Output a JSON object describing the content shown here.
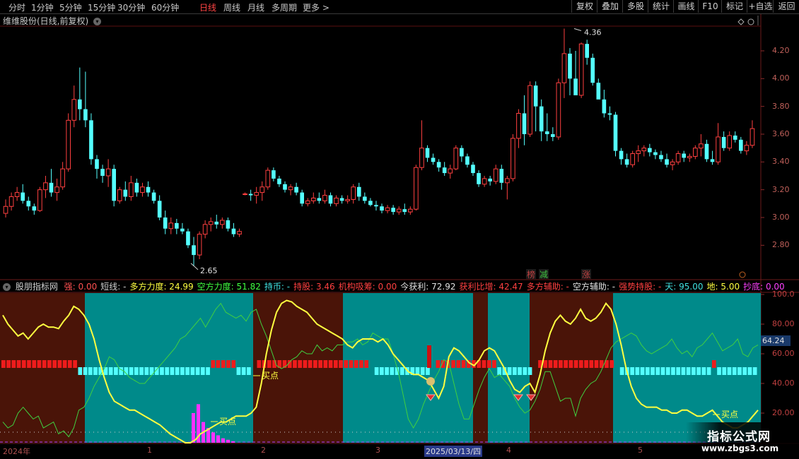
{
  "toolbar": {
    "timeframes": [
      "分时",
      "1分钟",
      "5分钟",
      "15分钟",
      "30分钟",
      "60分钟",
      "日线",
      "周线",
      "月线",
      "多周期",
      "更多 >"
    ],
    "active": "日线",
    "buttons": [
      "复权",
      "叠加",
      "多股",
      "统计",
      "画线",
      "F10",
      "标记",
      "+自选",
      "返回"
    ]
  },
  "stock": {
    "title": "维维股份(日线,前复权)"
  },
  "price_axis": {
    "labels": [
      "4.20",
      "4.00",
      "3.80",
      "3.60",
      "3.40",
      "3.20",
      "3.00",
      "2.80"
    ]
  },
  "price_annotations": {
    "high": "4.36",
    "low": "2.65"
  },
  "event_tags": [
    "榜",
    "减",
    "涨"
  ],
  "indicator": {
    "name": "股朋指标网",
    "params": [
      {
        "label": "强: 0.00",
        "color": "#ff5050"
      },
      {
        "label": "短线: -",
        "color": "#d0d0d0"
      },
      {
        "label": "多方力度: 24.99",
        "color": "#ffff40"
      },
      {
        "label": "空方力度: 51.82",
        "color": "#40ff40"
      },
      {
        "label": "持币: -",
        "color": "#40e0e0"
      },
      {
        "label": "持股: 3.46",
        "color": "#ff4040"
      },
      {
        "label": "机构吸筹: 0.00",
        "color": "#ff4040"
      },
      {
        "label": "今获利: 72.92",
        "color": "#e0e0e0"
      },
      {
        "label": "获利比增: 42.47",
        "color": "#ff4040"
      },
      {
        "label": "多方辅助: -",
        "color": "#ff4040"
      },
      {
        "label": "空方辅助: -",
        "color": "#e0e0e0"
      },
      {
        "label": "强势持股: -",
        "color": "#ff4040"
      },
      {
        "label": "天: 95.00",
        "color": "#40e0e0"
      },
      {
        "label": "地: 5.00",
        "color": "#ffff40"
      },
      {
        "label": "抄底: 0.00",
        "color": "#ff40ff"
      }
    ],
    "axis_labels": [
      "100.0",
      "80.00",
      "60.00",
      "40.00",
      "20.00"
    ],
    "current_value": "64.24",
    "buy_label": "买点"
  },
  "time_axis": {
    "labels": [
      "2024年",
      "1",
      "2",
      "3",
      "2025/03/13/四",
      "4",
      "5"
    ]
  },
  "watermark": {
    "title": "指标公式网",
    "url": "www.zbgs3.com"
  },
  "colors": {
    "up": "#ff4040",
    "down": "#54ffff",
    "bg_red": "#4a1408",
    "bg_teal": "#008a8a",
    "yellow": "#ffff40",
    "green": "#40d040",
    "magenta": "#ff30ff"
  },
  "chart_data": {
    "type": "candlestick",
    "ylim": [
      2.65,
      4.36
    ],
    "ohlc": [
      [
        3.03,
        3.13,
        3.0,
        3.08
      ],
      [
        3.08,
        3.18,
        3.05,
        3.15
      ],
      [
        3.15,
        3.22,
        3.12,
        3.18
      ],
      [
        3.18,
        3.24,
        3.1,
        3.12
      ],
      [
        3.12,
        3.15,
        3.05,
        3.08
      ],
      [
        3.08,
        3.1,
        3.02,
        3.05
      ],
      [
        3.05,
        3.22,
        3.04,
        3.2
      ],
      [
        3.2,
        3.3,
        3.14,
        3.25
      ],
      [
        3.25,
        3.35,
        3.15,
        3.18
      ],
      [
        3.18,
        3.28,
        3.12,
        3.22
      ],
      [
        3.22,
        3.4,
        3.2,
        3.35
      ],
      [
        3.35,
        3.75,
        3.33,
        3.7
      ],
      [
        3.7,
        3.95,
        3.65,
        3.85
      ],
      [
        3.85,
        4.08,
        3.7,
        3.78
      ],
      [
        3.78,
        4.05,
        3.65,
        3.7
      ],
      [
        3.7,
        3.75,
        3.38,
        3.42
      ],
      [
        3.42,
        3.45,
        3.28,
        3.35
      ],
      [
        3.35,
        3.38,
        3.25,
        3.3
      ],
      [
        3.3,
        3.42,
        3.22,
        3.35
      ],
      [
        3.35,
        3.38,
        3.08,
        3.12
      ],
      [
        3.12,
        3.22,
        3.1,
        3.2
      ],
      [
        3.2,
        3.26,
        3.12,
        3.15
      ],
      [
        3.15,
        3.3,
        3.12,
        3.25
      ],
      [
        3.25,
        3.28,
        3.15,
        3.18
      ],
      [
        3.18,
        3.25,
        3.15,
        3.22
      ],
      [
        3.22,
        3.26,
        3.15,
        3.18
      ],
      [
        3.18,
        3.2,
        3.1,
        3.12
      ],
      [
        3.12,
        3.16,
        2.98,
        3.0
      ],
      [
        3.0,
        3.05,
        2.88,
        2.92
      ],
      [
        2.92,
        3.0,
        2.88,
        2.96
      ],
      [
        2.96,
        2.99,
        2.88,
        2.92
      ],
      [
        2.92,
        2.96,
        2.88,
        2.9
      ],
      [
        2.9,
        2.92,
        2.78,
        2.8
      ],
      [
        2.8,
        2.86,
        2.65,
        2.73
      ],
      [
        2.73,
        2.9,
        2.7,
        2.88
      ],
      [
        2.88,
        2.98,
        2.85,
        2.95
      ],
      [
        2.95,
        3.0,
        2.9,
        2.97
      ],
      [
        2.97,
        3.02,
        2.92,
        2.95
      ],
      [
        2.95,
        3.0,
        2.92,
        2.98
      ],
      [
        2.98,
        3.0,
        2.9,
        2.92
      ],
      [
        2.92,
        2.96,
        2.86,
        2.88
      ],
      [
        2.88,
        2.92,
        2.86,
        2.9
      ],
      [
        3.17,
        3.18,
        3.16,
        3.17
      ],
      [
        3.17,
        3.2,
        3.12,
        3.16
      ],
      [
        3.16,
        3.22,
        3.1,
        3.18
      ],
      [
        3.18,
        3.26,
        3.12,
        3.22
      ],
      [
        3.22,
        3.36,
        3.2,
        3.34
      ],
      [
        3.34,
        3.36,
        3.26,
        3.28
      ],
      [
        3.28,
        3.3,
        3.22,
        3.24
      ],
      [
        3.24,
        3.26,
        3.18,
        3.2
      ],
      [
        3.2,
        3.24,
        3.16,
        3.22
      ],
      [
        3.22,
        3.25,
        3.16,
        3.18
      ],
      [
        3.18,
        3.2,
        3.08,
        3.1
      ],
      [
        3.1,
        3.14,
        3.08,
        3.12
      ],
      [
        3.12,
        3.18,
        3.1,
        3.14
      ],
      [
        3.14,
        3.18,
        3.1,
        3.12
      ],
      [
        3.12,
        3.2,
        3.1,
        3.16
      ],
      [
        3.16,
        3.18,
        3.08,
        3.1
      ],
      [
        3.1,
        3.16,
        3.08,
        3.14
      ],
      [
        3.14,
        3.16,
        3.1,
        3.12
      ],
      [
        3.12,
        3.16,
        3.1,
        3.13
      ],
      [
        3.13,
        3.24,
        3.1,
        3.22
      ],
      [
        3.22,
        3.25,
        3.12,
        3.15
      ],
      [
        3.15,
        3.18,
        3.1,
        3.12
      ],
      [
        3.12,
        3.14,
        3.08,
        3.09
      ],
      [
        3.09,
        3.12,
        3.05,
        3.08
      ],
      [
        3.08,
        3.1,
        3.03,
        3.05
      ],
      [
        3.05,
        3.09,
        3.03,
        3.07
      ],
      [
        3.07,
        3.09,
        3.02,
        3.04
      ],
      [
        3.04,
        3.08,
        3.02,
        3.06
      ],
      [
        3.06,
        3.1,
        3.02,
        3.04
      ],
      [
        3.04,
        3.08,
        3.02,
        3.06
      ],
      [
        3.06,
        3.38,
        3.05,
        3.36
      ],
      [
        3.36,
        3.7,
        3.34,
        3.5
      ],
      [
        3.5,
        3.52,
        3.4,
        3.43
      ],
      [
        3.43,
        3.46,
        3.38,
        3.4
      ],
      [
        3.4,
        3.42,
        3.33,
        3.36
      ],
      [
        3.36,
        3.4,
        3.3,
        3.32
      ],
      [
        3.32,
        3.38,
        3.28,
        3.35
      ],
      [
        3.35,
        3.52,
        3.34,
        3.5
      ],
      [
        3.5,
        3.52,
        3.4,
        3.44
      ],
      [
        3.44,
        3.46,
        3.36,
        3.38
      ],
      [
        3.38,
        3.4,
        3.3,
        3.32
      ],
      [
        3.32,
        3.34,
        3.22,
        3.24
      ],
      [
        3.24,
        3.3,
        3.22,
        3.28
      ],
      [
        3.28,
        3.3,
        3.23,
        3.26
      ],
      [
        3.26,
        3.38,
        3.24,
        3.35
      ],
      [
        3.35,
        3.38,
        3.2,
        3.25
      ],
      [
        3.25,
        3.3,
        3.13,
        3.28
      ],
      [
        3.28,
        3.6,
        3.26,
        3.57
      ],
      [
        3.57,
        3.78,
        3.5,
        3.75
      ],
      [
        3.75,
        3.88,
        3.52,
        3.6
      ],
      [
        3.6,
        3.98,
        3.58,
        3.95
      ],
      [
        3.95,
        3.98,
        3.62,
        3.8
      ],
      [
        3.8,
        3.85,
        3.55,
        3.62
      ],
      [
        3.62,
        3.75,
        3.55,
        3.6
      ],
      [
        3.6,
        3.65,
        3.55,
        3.58
      ],
      [
        3.58,
        4.0,
        3.56,
        3.97
      ],
      [
        3.97,
        4.36,
        3.86,
        4.18
      ],
      [
        4.18,
        4.22,
        3.88,
        4.0
      ],
      [
        4.0,
        4.2,
        3.95,
        3.88
      ],
      [
        3.88,
        4.26,
        3.86,
        4.25
      ],
      [
        4.25,
        4.28,
        4.1,
        4.15
      ],
      [
        4.15,
        4.18,
        3.95,
        3.97
      ],
      [
        3.97,
        4.0,
        3.88,
        3.85
      ],
      [
        3.85,
        3.92,
        3.72,
        3.75
      ],
      [
        3.75,
        3.8,
        3.7,
        3.74
      ],
      [
        3.74,
        3.76,
        3.44,
        3.48
      ],
      [
        3.48,
        3.5,
        3.38,
        3.42
      ],
      [
        3.42,
        3.46,
        3.36,
        3.38
      ],
      [
        3.38,
        3.48,
        3.36,
        3.46
      ],
      [
        3.46,
        3.52,
        3.4,
        3.48
      ],
      [
        3.48,
        3.52,
        3.44,
        3.5
      ],
      [
        3.5,
        3.53,
        3.44,
        3.47
      ],
      [
        3.47,
        3.49,
        3.42,
        3.45
      ],
      [
        3.45,
        3.48,
        3.4,
        3.42
      ],
      [
        3.42,
        3.46,
        3.36,
        3.38
      ],
      [
        3.38,
        3.42,
        3.34,
        3.4
      ],
      [
        3.4,
        3.48,
        3.38,
        3.46
      ],
      [
        3.46,
        3.48,
        3.4,
        3.43
      ],
      [
        3.43,
        3.46,
        3.4,
        3.44
      ],
      [
        3.44,
        3.52,
        3.42,
        3.5
      ],
      [
        3.5,
        3.6,
        3.44,
        3.53
      ],
      [
        3.53,
        3.56,
        3.4,
        3.42
      ],
      [
        3.42,
        3.48,
        3.38,
        3.4
      ],
      [
        3.4,
        3.68,
        3.38,
        3.58
      ],
      [
        3.58,
        3.62,
        3.48,
        3.5
      ],
      [
        3.5,
        3.62,
        3.48,
        3.59
      ],
      [
        3.59,
        3.62,
        3.54,
        3.56
      ],
      [
        3.56,
        3.58,
        3.46,
        3.48
      ],
      [
        3.48,
        3.55,
        3.45,
        3.52
      ],
      [
        3.52,
        3.7,
        3.5,
        3.64
      ]
    ],
    "indicator_yellow": [
      86,
      80,
      76,
      72,
      74,
      70,
      74,
      78,
      80,
      78,
      78,
      77,
      82,
      86,
      92,
      90,
      86,
      80,
      70,
      56,
      44,
      34,
      28,
      26,
      24,
      22,
      22,
      20,
      18,
      16,
      14,
      12,
      9,
      6,
      4,
      2,
      0,
      0,
      2,
      6,
      8,
      10,
      12,
      14,
      14,
      16,
      18,
      18,
      18,
      20,
      24,
      40,
      60,
      76,
      88,
      94,
      96,
      95,
      92,
      90,
      88,
      84,
      80,
      78,
      76,
      74,
      72,
      70,
      66,
      64,
      68,
      70,
      70,
      70,
      68,
      70,
      66,
      60,
      56,
      52,
      48,
      46,
      46,
      44,
      42,
      36,
      30,
      38,
      58,
      64,
      62,
      58,
      54,
      52,
      56,
      62,
      64,
      62,
      56,
      50,
      42,
      36,
      34,
      38,
      40,
      34,
      46,
      62,
      74,
      82,
      86,
      82,
      80,
      84,
      90,
      84,
      82,
      84,
      88,
      94,
      90,
      80,
      66,
      50,
      38,
      30,
      26,
      24,
      24,
      24,
      22,
      22,
      20,
      20,
      22,
      22,
      20,
      18,
      18,
      20,
      22,
      18,
      14,
      12,
      10,
      10,
      12,
      14,
      18,
      22
    ],
    "indicator_green": [
      14,
      10,
      12,
      20,
      24,
      20,
      16,
      18,
      10,
      12,
      14,
      6,
      8,
      4,
      10,
      22,
      24,
      30,
      38,
      44,
      50,
      58,
      56,
      50,
      48,
      44,
      42,
      40,
      40,
      44,
      48,
      52,
      56,
      60,
      64,
      70,
      72,
      76,
      80,
      84,
      78,
      84,
      90,
      94,
      88,
      86,
      84,
      86,
      82,
      88,
      90,
      80,
      72,
      62,
      52,
      50,
      52,
      56,
      58,
      62,
      60,
      60,
      66,
      62,
      64,
      62,
      66,
      66,
      68,
      68,
      70,
      66,
      68,
      74,
      72,
      70,
      70,
      60,
      48,
      32,
      16,
      10,
      16,
      26,
      34,
      42,
      48,
      56,
      54,
      40,
      26,
      16,
      16,
      26,
      36,
      44,
      50,
      44,
      46,
      42,
      38,
      30,
      24,
      20,
      22,
      28,
      36,
      48,
      48,
      38,
      28,
      30,
      30,
      18,
      30,
      36,
      40,
      42,
      48,
      56,
      64,
      68,
      70,
      72,
      74,
      72,
      66,
      62,
      60,
      62,
      64,
      66,
      70,
      64,
      60,
      62,
      58,
      64,
      66,
      70,
      74,
      68,
      62,
      64,
      66,
      70,
      60,
      58,
      64,
      66
    ],
    "magenta_bars": [
      0,
      0,
      0,
      20,
      26,
      14,
      10,
      7,
      5,
      3,
      2,
      1
    ],
    "red_bars_extra": [
      0,
      0,
      0,
      0,
      0,
      0,
      0,
      0,
      0,
      0,
      0,
      0
    ]
  }
}
